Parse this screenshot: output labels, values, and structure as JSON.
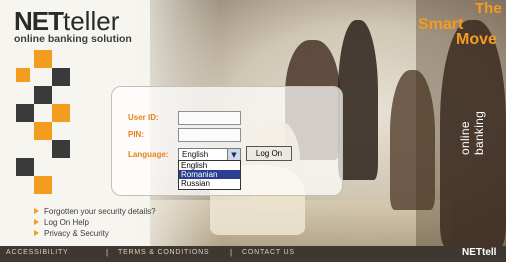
{
  "brand": {
    "logo_net": "NET",
    "logo_teller": "teller",
    "tagline": "online banking solution",
    "slogan_the": "The",
    "slogan_smart": "Smart",
    "slogan_move": "Move",
    "vertical_text": "online banking"
  },
  "login": {
    "user_id_label": "User ID:",
    "pin_label": "PIN:",
    "language_label": "Language:",
    "language_selected": "English",
    "language_options": [
      "English",
      "Romanian",
      "Russian"
    ],
    "language_highlighted": "Romanian",
    "logon_button": "Log On"
  },
  "links": [
    "Forgotten your security details?",
    "Log On Help",
    "Privacy & Security"
  ],
  "footer": {
    "accessibility": "ACCESSIBILITY",
    "terms": "TERMS & CONDITIONS",
    "contact": "CONTACT US",
    "separator": "|",
    "footer_logo": "NETtell"
  },
  "colors": {
    "accent_orange": "#f39c1f",
    "label_orange": "#e7811a",
    "footer_bg": "#3e3831",
    "selection_blue": "#2a3f8f"
  }
}
